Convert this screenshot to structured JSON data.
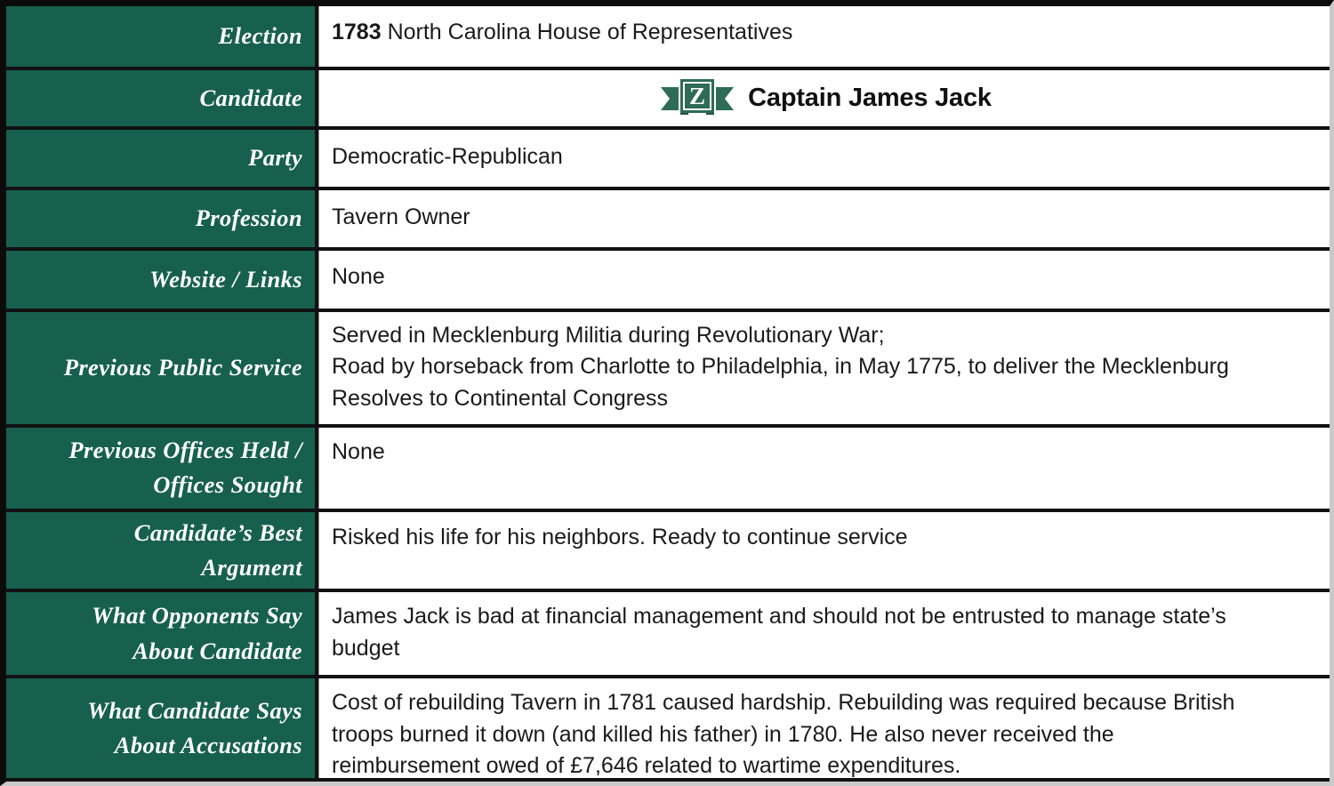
{
  "colors": {
    "label_bg": "#17604E",
    "label_text": "#FFFFFF",
    "value_text": "#1A1A1A",
    "border": "#111111",
    "logo_green": "#2F6B57"
  },
  "logo": {
    "letter": "Z",
    "name": "z-ribbon-logo"
  },
  "rows": [
    {
      "key": "election",
      "label_lines": [
        "Election"
      ],
      "value_lead": "1783",
      "value_lines": [
        " North Carolina House of Representatives"
      ]
    },
    {
      "key": "candidate",
      "label_lines": [
        "Candidate"
      ],
      "value_lines": [
        "Captain James Jack"
      ]
    },
    {
      "key": "party",
      "label_lines": [
        "Party"
      ],
      "value_lines": [
        "Democratic-Republican"
      ]
    },
    {
      "key": "profession",
      "label_lines": [
        "Profession"
      ],
      "value_lines": [
        "Tavern Owner"
      ]
    },
    {
      "key": "website",
      "label_lines": [
        "Website / Links"
      ],
      "value_lines": [
        "None"
      ]
    },
    {
      "key": "previous_public_service",
      "label_lines": [
        "Previous Public Service"
      ],
      "value_lines": [
        "Served in Mecklenburg Militia during Revolutionary War;",
        "Road by horseback from Charlotte to Philadelphia, in May 1775, to deliver the Mecklenburg",
        "Resolves to Continental Congress"
      ]
    },
    {
      "key": "previous_offices",
      "label_lines": [
        "Previous Offices Held /",
        "Offices Sought"
      ],
      "value_lines": [
        "None"
      ]
    },
    {
      "key": "best_argument",
      "label_lines": [
        "Candidate’s Best",
        "Argument"
      ],
      "value_lines": [
        "Risked his life for his neighbors. Ready to continue service"
      ]
    },
    {
      "key": "opponents_say",
      "label_lines": [
        "What Opponents Say",
        "About Candidate"
      ],
      "value_lines": [
        "James Jack is bad at financial management and should not be entrusted to manage state’s",
        "budget"
      ]
    },
    {
      "key": "candidate_says",
      "label_lines": [
        "What Candidate Says",
        "About Accusations"
      ],
      "value_lines": [
        "Cost of rebuilding Tavern in 1781 caused hardship. Rebuilding was required because British",
        "troops burned it down (and killed his father) in 1780. He also never received the",
        "reimbursement owed of £7,646 related to wartime expenditures."
      ]
    }
  ]
}
